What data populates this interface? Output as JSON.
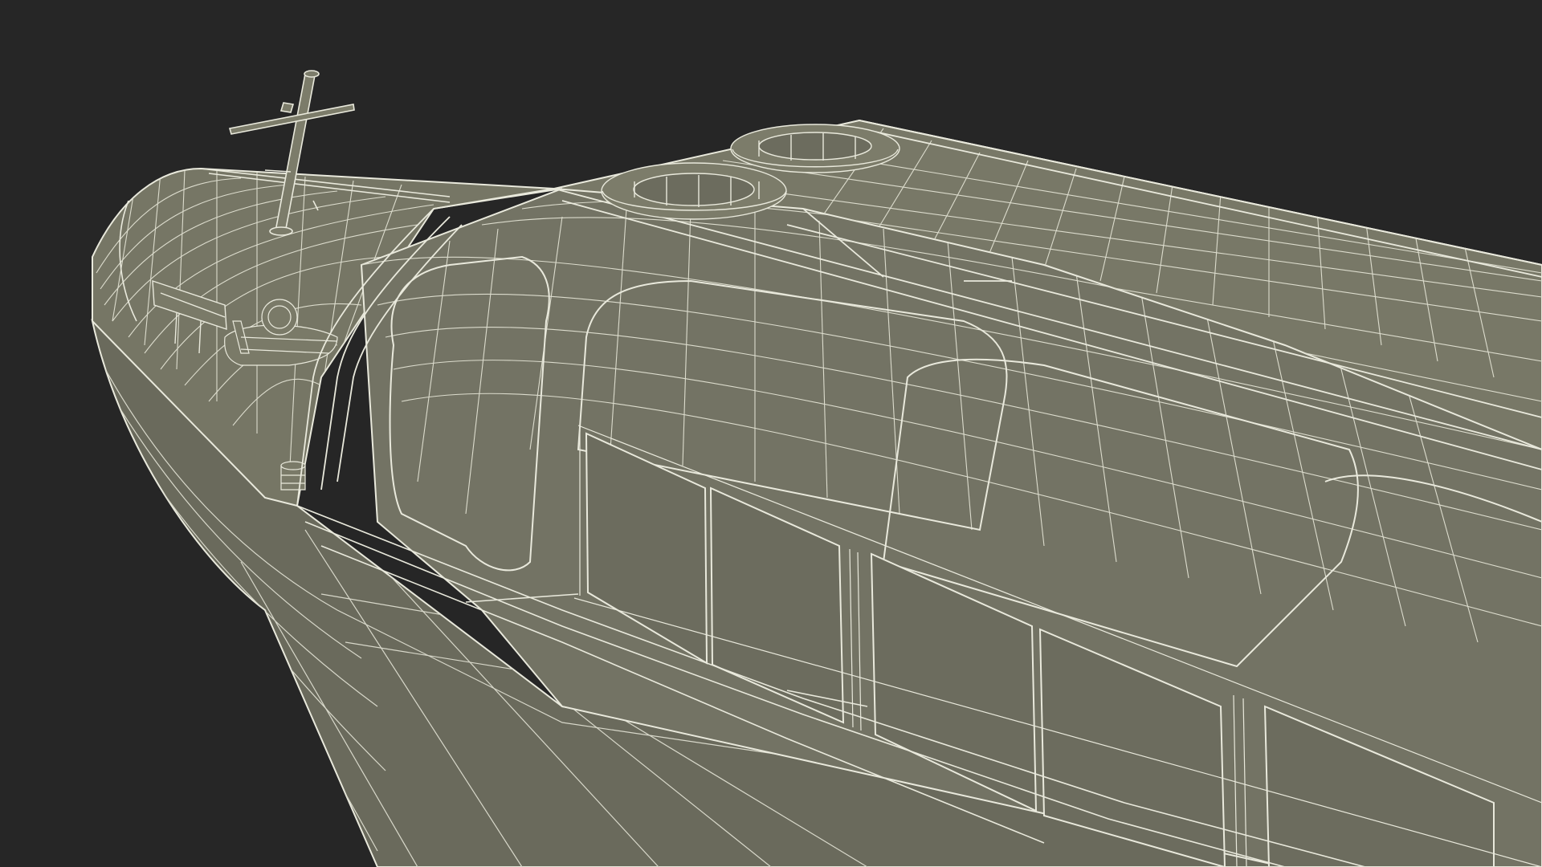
{
  "scene": {
    "background_color": "#262626",
    "hull_fill": "#727262",
    "hull_fill_dark": "#66665a",
    "window_fill": "#6c6c5e",
    "wire_color": "#e9e9dc",
    "wire_color_dim": "#cfcfbf",
    "subject": "boat-wireframe-model"
  }
}
